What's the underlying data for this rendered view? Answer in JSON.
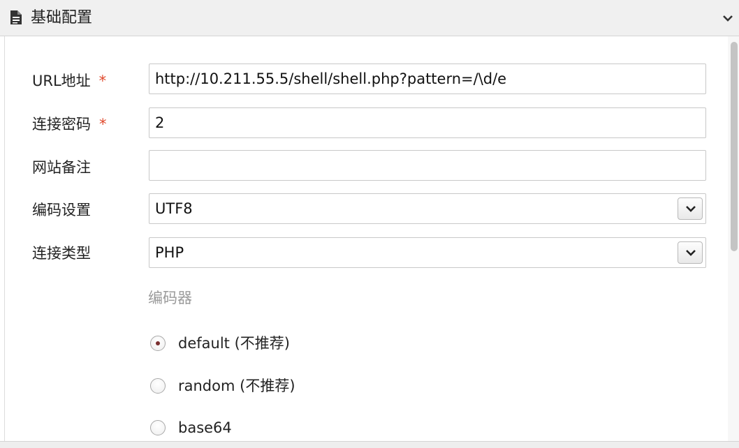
{
  "panel": {
    "title": "基础配置"
  },
  "form": {
    "url": {
      "label": "URL地址",
      "required": "*",
      "value": "http://10.211.55.5/shell/shell.php?pattern=/\\d/e"
    },
    "password": {
      "label": "连接密码",
      "required": "*",
      "value": "2"
    },
    "note": {
      "label": "网站备注",
      "value": ""
    },
    "encoding": {
      "label": "编码设置",
      "value": "UTF8"
    },
    "type": {
      "label": "连接类型",
      "value": "PHP"
    }
  },
  "encoder": {
    "label": "编码器",
    "options": [
      {
        "label": "default (不推荐)",
        "checked": true
      },
      {
        "label": "random (不推荐)",
        "checked": false
      },
      {
        "label": "base64",
        "checked": false
      }
    ]
  },
  "icons": {
    "header": "document-icon",
    "collapse": "chevron-down-icon",
    "select": "chevron-down-icon"
  },
  "colors": {
    "required": "#e0492c",
    "header_bg": "#f0f0f0",
    "muted_label": "#9a9a9a"
  }
}
